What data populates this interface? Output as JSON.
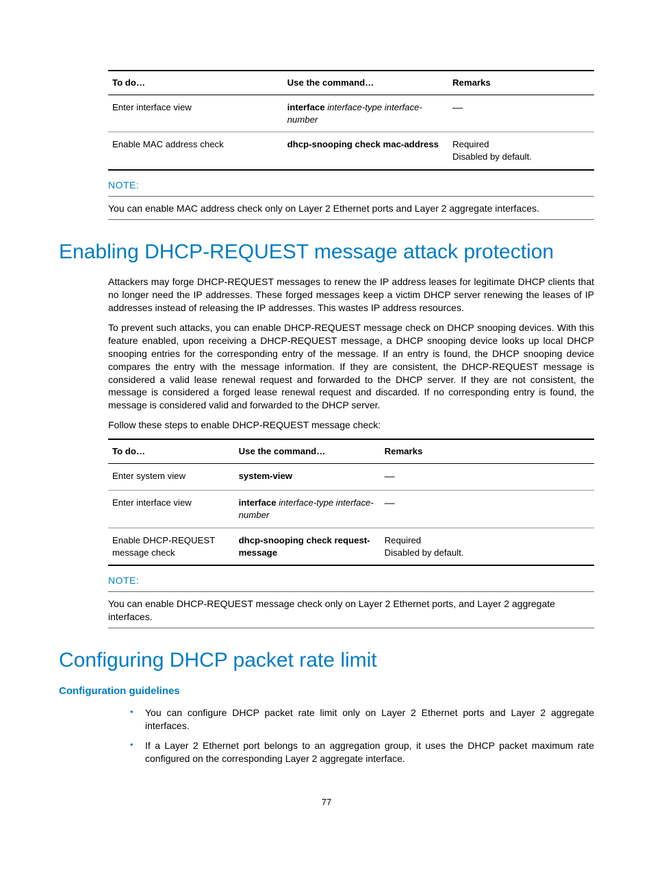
{
  "table1": {
    "headers": {
      "c1": "To do…",
      "c2": "Use the command…",
      "c3": "Remarks"
    },
    "rows": [
      {
        "c1": "Enter interface view",
        "c2_bold": "interface",
        "c2_ital": " interface-type interface-number",
        "c3": "—"
      },
      {
        "c1": "Enable MAC address check",
        "c2_bold": "dhcp-snooping check mac-address",
        "c2_ital": "",
        "c3": "Required\nDisabled by default."
      }
    ]
  },
  "note1": {
    "label": "NOTE:",
    "text": "You can enable MAC address check only on Layer 2 Ethernet ports and Layer 2 aggregate interfaces."
  },
  "h1a": "Enabling DHCP-REQUEST message attack protection",
  "p1": "Attackers may forge DHCP-REQUEST messages to renew the IP address leases for legitimate DHCP clients that no longer need the IP addresses. These forged messages keep a victim DHCP server renewing the leases of IP addresses instead of releasing the IP addresses. This wastes IP address resources.",
  "p2": "To prevent such attacks, you can enable DHCP-REQUEST message check on DHCP snooping devices. With this feature enabled, upon receiving a DHCP-REQUEST message, a DHCP snooping device looks up local DHCP snooping entries for the corresponding entry of the message. If an entry is found, the DHCP snooping device compares the entry with the message information. If they are consistent, the DHCP-REQUEST message is considered a valid lease renewal request and forwarded to the DHCP server. If they are not consistent, the message is considered a forged lease renewal request and discarded. If no corresponding entry is found, the message is considered valid and forwarded to the DHCP server.",
  "p3": "Follow these steps to enable DHCP-REQUEST message check:",
  "table2": {
    "headers": {
      "c1": "To do…",
      "c2": "Use the command…",
      "c3": "Remarks"
    },
    "rows": [
      {
        "c1": "Enter system view",
        "c2_bold": "system-view",
        "c2_ital": "",
        "c3": "—"
      },
      {
        "c1": "Enter interface view",
        "c2_bold": "interface",
        "c2_ital": " interface-type interface-number",
        "c3": "—"
      },
      {
        "c1": "Enable DHCP-REQUEST message check",
        "c2_bold": "dhcp-snooping check request-message",
        "c2_ital": "",
        "c3": "Required\nDisabled by default."
      }
    ]
  },
  "note2": {
    "label": "NOTE:",
    "text": "You can enable DHCP-REQUEST message check only on Layer 2 Ethernet ports, and Layer 2 aggregate interfaces."
  },
  "h1b": "Configuring DHCP packet rate limit",
  "h2a": "Configuration guidelines",
  "bullets": [
    "You can configure DHCP packet rate limit only on Layer 2 Ethernet ports and Layer 2 aggregate interfaces.",
    "If a Layer 2 Ethernet port belongs to an aggregation group, it uses the DHCP packet maximum rate configured on the corresponding Layer 2 aggregate interface."
  ],
  "pagenum": "77"
}
